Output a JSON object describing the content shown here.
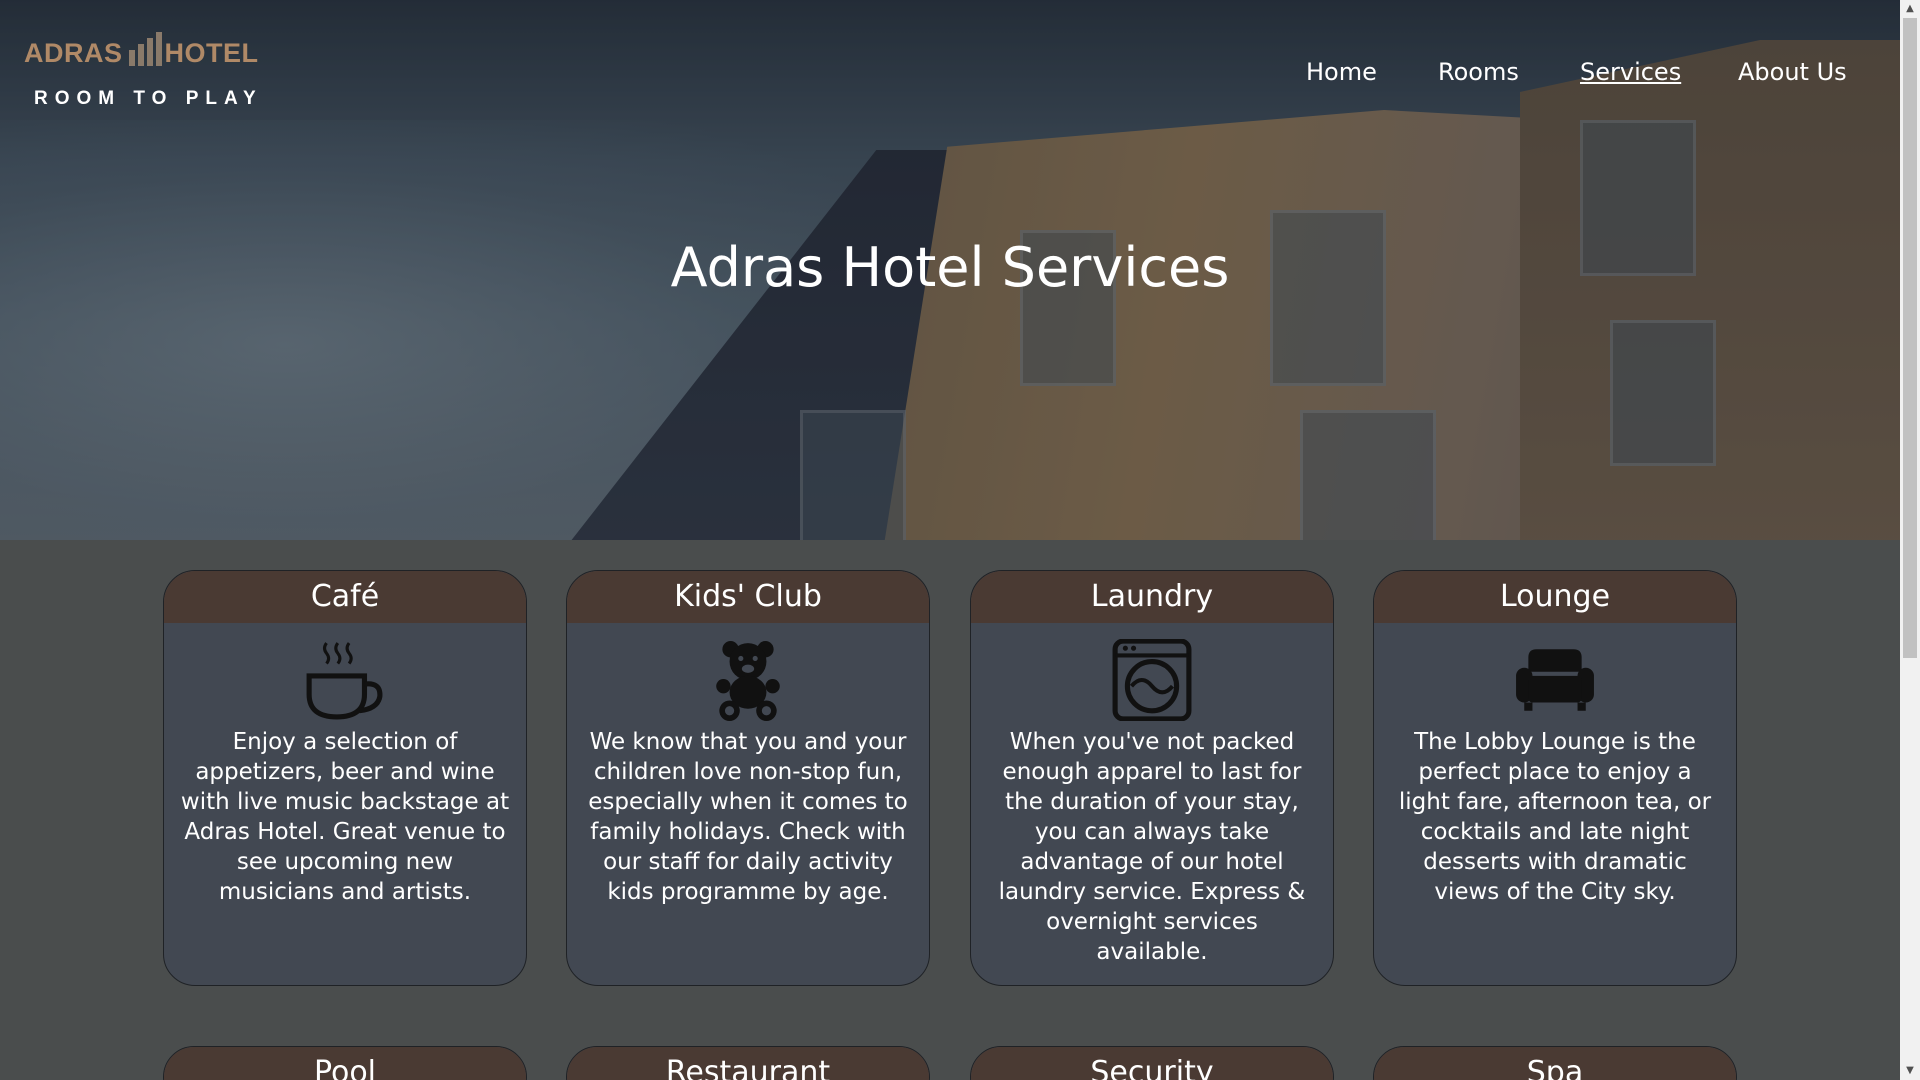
{
  "brand": {
    "logo_top": "ADRAS",
    "logo_top_right": "HOTEL",
    "tagline": "ROOM TO PLAY"
  },
  "nav": {
    "items": [
      {
        "label": "Home",
        "active": false
      },
      {
        "label": "Rooms",
        "active": false
      },
      {
        "label": "Services",
        "active": true
      },
      {
        "label": "About Us",
        "active": false
      }
    ]
  },
  "hero": {
    "title": "Adras Hotel Services"
  },
  "services": [
    {
      "title": "Café",
      "icon": "coffee-cup-icon",
      "text": "Enjoy a selection of appetizers, beer and wine with live music backstage at Adras Hotel. Great venue to see upcoming new musicians and artists."
    },
    {
      "title": "Kids' Club",
      "icon": "teddy-bear-icon",
      "text": "We know that you and your children love non-stop fun, especially when it comes to family holidays. Check with our staff for daily activity kids programme by age."
    },
    {
      "title": "Laundry",
      "icon": "washing-machine-icon",
      "text": "When you've not packed enough apparel to last for the duration of your stay, you can always take advantage of our hotel laundry service. Express & overnight services available."
    },
    {
      "title": "Lounge",
      "icon": "sofa-icon",
      "text": "The Lobby Lounge is the perfect place to enjoy a light fare, afternoon tea, or cocktails and late night desserts with dramatic views of the City sky."
    },
    {
      "title": "Pool"
    },
    {
      "title": "Restaurant"
    },
    {
      "title": "Security"
    },
    {
      "title": "Spa"
    }
  ],
  "colors": {
    "card_header": "#4a3a33",
    "card_body": "#424852",
    "page_background": "#4a4d4d",
    "logo_accent": "#b08967"
  }
}
